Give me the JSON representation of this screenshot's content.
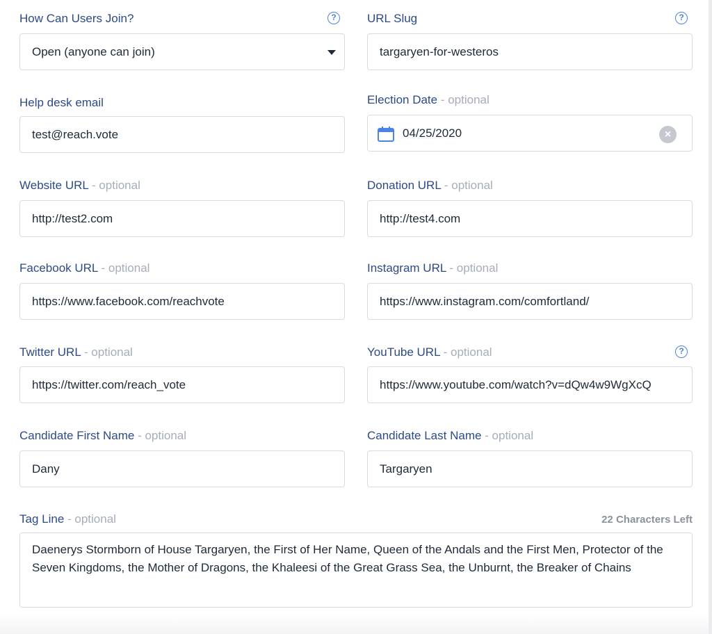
{
  "fields": {
    "join": {
      "label": "How Can Users Join?",
      "value": "Open (anyone can join)"
    },
    "slug": {
      "label": "URL Slug",
      "value": "targaryen-for-westeros"
    },
    "helpdesk": {
      "label": "Help desk email",
      "value": "test@reach.vote"
    },
    "election": {
      "label": "Election Date",
      "optional": " - optional",
      "value": "04/25/2020"
    },
    "website": {
      "label": "Website URL",
      "optional": " - optional",
      "value": "http://test2.com"
    },
    "donation": {
      "label": "Donation URL",
      "optional": " - optional",
      "value": "http://test4.com"
    },
    "facebook": {
      "label": "Facebook URL",
      "optional": " - optional",
      "value": "https://www.facebook.com/reachvote"
    },
    "instagram": {
      "label": "Instagram URL",
      "optional": " - optional",
      "value": "https://www.instagram.com/comfortland/"
    },
    "twitter": {
      "label": "Twitter URL",
      "optional": " - optional",
      "value": "https://twitter.com/reach_vote"
    },
    "youtube": {
      "label": "YouTube URL",
      "optional": " - optional",
      "value": "https://www.youtube.com/watch?v=dQw4w9WgXcQ"
    },
    "firstname": {
      "label": "Candidate First Name",
      "optional": " - optional",
      "value": "Dany"
    },
    "lastname": {
      "label": "Candidate Last Name",
      "optional": " - optional",
      "value": "Targaryen"
    },
    "tagline": {
      "label": "Tag Line",
      "optional": " - optional",
      "chars_left": "22 Characters Left",
      "value": "Daenerys Stormborn of House Targaryen, the First of Her Name, Queen of the Andals and the First Men, Protector of the Seven Kingdoms, the Mother of Dragons, the Khaleesi of the Great Grass Sea, the Unburnt, the Breaker of Chains"
    }
  },
  "icons": {
    "help": "?",
    "clear": "×",
    "calendar": "calendar-icon",
    "dropdown": "chevron-down-icon"
  },
  "colors": {
    "label": "#2c4a86",
    "optional": "#a7adb7",
    "accent": "#4d82e6",
    "border": "#d8dbe0"
  }
}
